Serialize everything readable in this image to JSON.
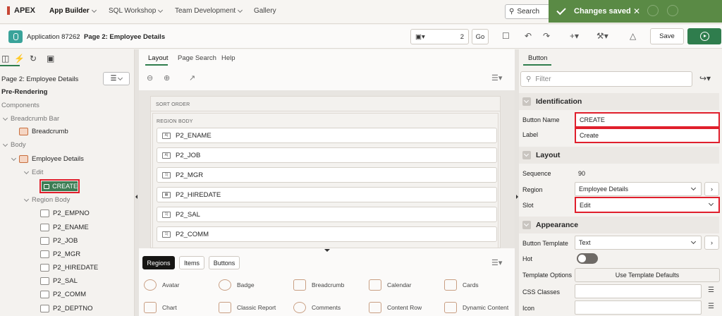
{
  "topnav": {
    "brand": "APEX",
    "tabs": [
      {
        "label": "App Builder"
      },
      {
        "label": "SQL Workshop"
      },
      {
        "label": "Team Development"
      },
      {
        "label": "Gallery"
      }
    ],
    "search_label": "Search"
  },
  "toast": {
    "message": "Changes saved"
  },
  "toolbar": {
    "app_crumb": "Application 87262",
    "page_crumb": "Page 2: Employee Details",
    "page_number": "2",
    "go_label": "Go",
    "save_label": "Save"
  },
  "left": {
    "page_title": "Page 2: Employee Details",
    "pre_rendering": "Pre-Rendering",
    "components": "Components",
    "breadcrumb_bar": "Breadcrumb Bar",
    "breadcrumb": "Breadcrumb",
    "body": "Body",
    "employee_details": "Employee Details",
    "edit": "Edit",
    "create": "CREATE",
    "region_body": "Region Body",
    "items": [
      "P2_EMPNO",
      "P2_ENAME",
      "P2_JOB",
      "P2_MGR",
      "P2_HIREDATE",
      "P2_SAL",
      "P2_COMM",
      "P2_DEPTNO"
    ]
  },
  "center": {
    "tabs": [
      "Layout",
      "Page Search",
      "Help"
    ],
    "sort_order": "SORT ORDER",
    "region_body": "REGION BODY",
    "items": [
      {
        "label": "P2_ENAME",
        "type": "A|"
      },
      {
        "label": "P2_JOB",
        "type": "A|"
      },
      {
        "label": "P2_MGR",
        "type": "1|"
      },
      {
        "label": "P2_HIREDATE",
        "type": "cal"
      },
      {
        "label": "P2_SAL",
        "type": "1|"
      },
      {
        "label": "P2_COMM",
        "type": "1|"
      }
    ],
    "gallery_tabs": [
      "Regions",
      "Items",
      "Buttons"
    ],
    "gallery_row1": [
      "Avatar",
      "Badge",
      "Breadcrumb",
      "Calendar",
      "Cards"
    ],
    "gallery_row2": [
      "Chart",
      "Classic Report",
      "Comments",
      "Content Row",
      "Dynamic Content"
    ]
  },
  "right": {
    "tab": "Button",
    "filter_placeholder": "Filter",
    "groups": {
      "identification": "Identification",
      "layout": "Layout",
      "appearance": "Appearance"
    },
    "props": {
      "button_name_label": "Button Name",
      "button_name_value": "CREATE",
      "label_label": "Label",
      "label_value": "Create",
      "sequence_label": "Sequence",
      "sequence_value": "90",
      "region_label": "Region",
      "region_value": "Employee Details",
      "slot_label": "Slot",
      "slot_value": "Edit",
      "button_template_label": "Button Template",
      "button_template_value": "Text",
      "hot_label": "Hot",
      "template_options_label": "Template Options",
      "template_options_button": "Use Template Defaults",
      "css_classes_label": "CSS Classes",
      "icon_label": "Icon"
    }
  },
  "colors": {
    "accent_green": "#2f7d4d",
    "highlight_red": "#e01f2c",
    "toast_green": "#5a8a45"
  }
}
